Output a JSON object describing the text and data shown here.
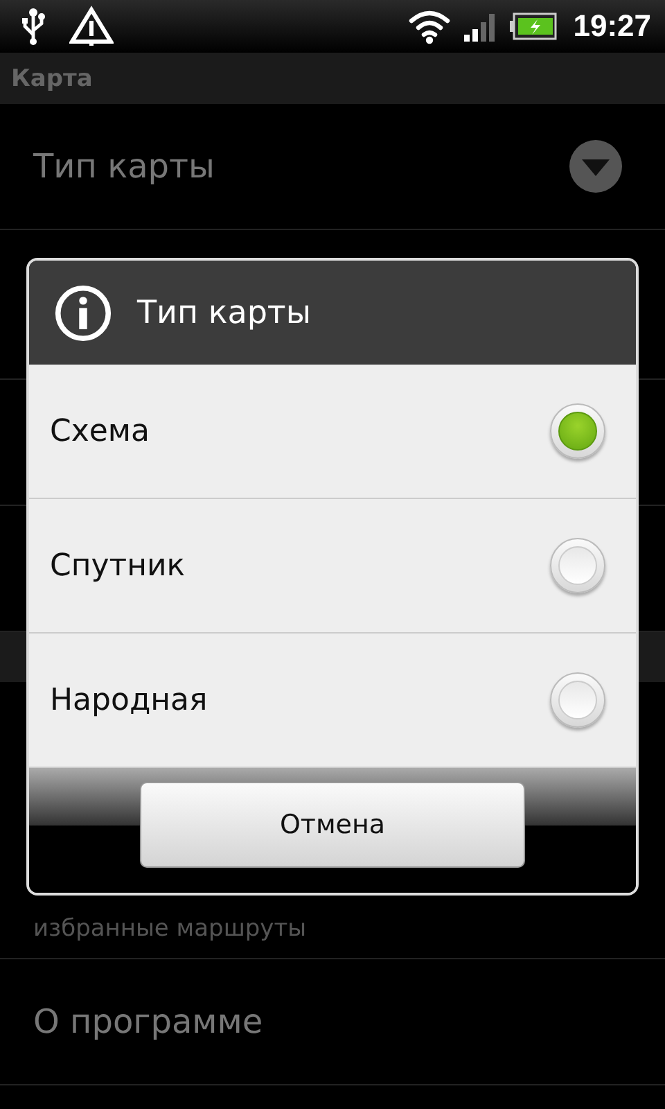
{
  "status_bar": {
    "time": "19:27"
  },
  "header": {
    "title": "Карта"
  },
  "settings": [
    {
      "kind": "dropdown",
      "title": "Тип карты"
    },
    {
      "kind": "blank"
    },
    {
      "kind": "blank"
    },
    {
      "kind": "blank"
    },
    {
      "kind": "section"
    },
    {
      "kind": "description",
      "description": "избранные маршруты"
    },
    {
      "kind": "plain",
      "title": "О программе"
    }
  ],
  "dialog": {
    "title": "Тип карты",
    "options": [
      {
        "label": "Схема",
        "selected": true
      },
      {
        "label": "Спутник",
        "selected": false
      },
      {
        "label": "Народная",
        "selected": false
      }
    ],
    "button": "Отмена"
  }
}
